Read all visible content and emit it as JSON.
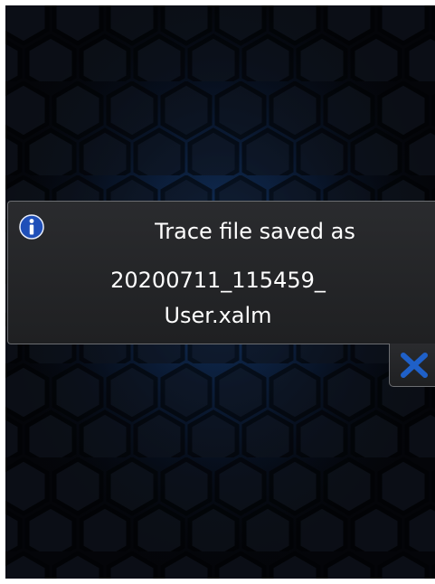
{
  "notification": {
    "icon": "info-icon",
    "title": "Trace file saved as",
    "filename_line1": "20200711_115459_",
    "filename_line2": "User.xalm",
    "close_icon": "close-icon"
  },
  "colors": {
    "background": "#05070c",
    "hex_glow": "#1e5aa8",
    "dialog_bg": "#252628",
    "dialog_border": "#6c6e72",
    "info_icon": "#1f4fb8",
    "close_icon": "#1f60c8",
    "text": "#ffffff"
  }
}
